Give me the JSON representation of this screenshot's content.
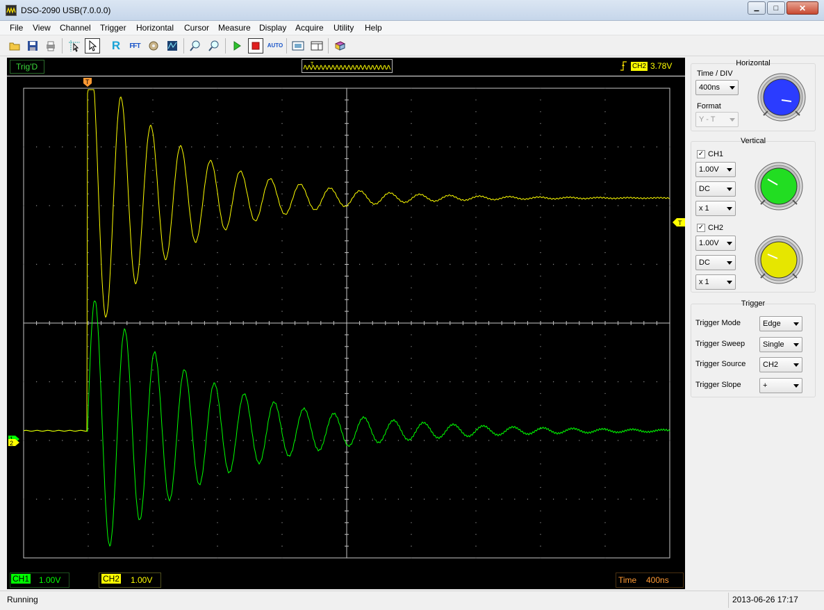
{
  "window": {
    "title": "DSO-2090 USB(7.0.0.0)",
    "minimize": "▁",
    "maximize": "□",
    "close": "✕"
  },
  "menu": [
    "File",
    "View",
    "Channel",
    "Trigger",
    "Horizontal",
    "Cursor",
    "Measure",
    "Display",
    "Acquire",
    "Utility",
    "Help"
  ],
  "toolbar": {
    "icons": [
      "open-icon",
      "save-icon",
      "print-icon",
      "cursor-select-icon",
      "pointer-icon",
      "reference-icon",
      "fft-icon",
      "settings-icon",
      "waveform-icon",
      "zoom-out-icon",
      "zoom-in-icon",
      "run-icon",
      "stop-icon",
      "auto-icon",
      "capture-icon",
      "window-icon",
      "book-icon"
    ],
    "ref_label": "R",
    "fft_label": "FFT",
    "auto_label": "AUTO"
  },
  "scope": {
    "trig_status": "Trig'D",
    "trigger_source": "CH2",
    "trigger_level": "3.78V",
    "trigger_marker": "T",
    "ch1_label": "CH1",
    "ch1_scale": "1.00V",
    "ch2_label": "CH2",
    "ch2_scale": "1.00V",
    "time_label": "Time",
    "time_scale": "400ns",
    "ch1_marker": "1",
    "ch2_marker": "2",
    "colors": {
      "ch1": "#00ff00",
      "ch2": "#ffff00",
      "trig": "#ff9933",
      "grid": "#c8c8c8"
    }
  },
  "horizontal": {
    "title": "Horizontal",
    "time_div_label": "Time / DIV",
    "time_div_value": "400ns",
    "format_label": "Format",
    "format_value": "Y - T",
    "knob_color": "#2b3cff"
  },
  "vertical": {
    "title": "Vertical",
    "ch1": {
      "label": "CH1",
      "checked": true,
      "volts": "1.00V",
      "coupling": "DC",
      "probe": "x 1",
      "knob_color": "#22dd22"
    },
    "ch2": {
      "label": "CH2",
      "checked": true,
      "volts": "1.00V",
      "coupling": "DC",
      "probe": "x 1",
      "knob_color": "#e6e600"
    }
  },
  "trigger": {
    "title": "Trigger",
    "mode_label": "Trigger Mode",
    "mode_value": "Edge",
    "sweep_label": "Trigger Sweep",
    "sweep_value": "Single",
    "source_label": "Trigger Source",
    "source_value": "CH2",
    "slope_label": "Trigger Slope",
    "slope_value": "+"
  },
  "status": {
    "text": "Running",
    "datetime": "2013-06-26  17:17"
  }
}
